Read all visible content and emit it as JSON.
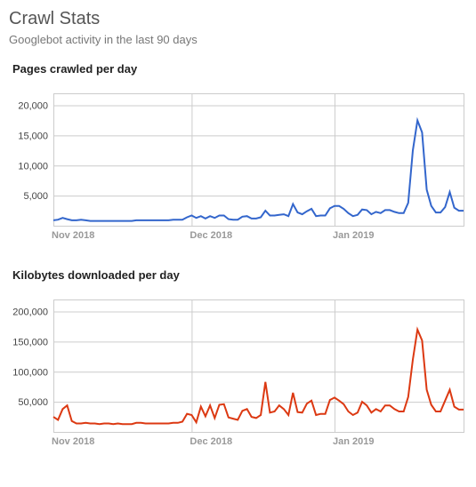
{
  "header": {
    "title": "Crawl Stats",
    "subtitle": "Googlebot activity in the last 90 days"
  },
  "pages_chart": {
    "title": "Pages crawled per day",
    "color": "#3366cc",
    "y_ticks": [
      "5,000",
      "10,000",
      "15,000",
      "20,000"
    ],
    "x_ticks": [
      "Nov 2018",
      "Dec 2018",
      "Jan 2019"
    ]
  },
  "kb_chart": {
    "title": "Kilobytes downloaded per day",
    "color": "#dc3912",
    "y_ticks": [
      "50,000",
      "100,000",
      "150,000",
      "200,000"
    ],
    "x_ticks": [
      "Nov 2018",
      "Dec 2018",
      "Jan 2019"
    ]
  },
  "chart_data": [
    {
      "type": "line",
      "title": "Pages crawled per day",
      "xlabel": "",
      "ylabel": "",
      "ylim": [
        0,
        22000
      ],
      "x_tick_positions": [
        0,
        30,
        61
      ],
      "x_tick_labels": [
        "Nov 2018",
        "Dec 2018",
        "Jan 2019"
      ],
      "y_tick_values": [
        5000,
        10000,
        15000,
        20000
      ],
      "series": [
        {
          "name": "Pages crawled per day",
          "color": "#3366cc",
          "x": [
            0,
            1,
            2,
            3,
            4,
            5,
            6,
            7,
            8,
            9,
            10,
            11,
            12,
            13,
            14,
            15,
            16,
            17,
            18,
            19,
            20,
            21,
            22,
            23,
            24,
            25,
            26,
            27,
            28,
            29,
            30,
            31,
            32,
            33,
            34,
            35,
            36,
            37,
            38,
            39,
            40,
            41,
            42,
            43,
            44,
            45,
            46,
            47,
            48,
            49,
            50,
            51,
            52,
            53,
            54,
            55,
            56,
            57,
            58,
            59,
            60,
            61,
            62,
            63,
            64,
            65,
            66,
            67,
            68,
            69,
            70,
            71,
            72,
            73,
            74,
            75,
            76,
            77,
            78,
            79,
            80,
            81,
            82,
            83,
            84,
            85,
            86,
            87,
            88,
            89
          ],
          "values": [
            900,
            1000,
            1300,
            1100,
            900,
            900,
            1000,
            900,
            800,
            800,
            800,
            800,
            800,
            800,
            800,
            800,
            800,
            800,
            900,
            900,
            900,
            900,
            900,
            900,
            900,
            900,
            1000,
            1000,
            1000,
            1400,
            1700,
            1300,
            1600,
            1200,
            1600,
            1300,
            1700,
            1700,
            1100,
            1000,
            1000,
            1500,
            1600,
            1200,
            1200,
            1400,
            2500,
            1700,
            1700,
            1800,
            1900,
            1600,
            3600,
            2200,
            1900,
            2400,
            2800,
            1600,
            1700,
            1700,
            2900,
            3300,
            3300,
            2800,
            2100,
            1600,
            1800,
            2700,
            2600,
            1900,
            2300,
            2100,
            2600,
            2600,
            2300,
            2100,
            2100,
            3800,
            12500,
            17500,
            15500,
            6000,
            3300,
            2200,
            2200,
            3100,
            5600,
            3000,
            2500,
            2500
          ]
        }
      ]
    },
    {
      "type": "line",
      "title": "Kilobytes downloaded per day",
      "xlabel": "",
      "ylabel": "",
      "ylim": [
        0,
        220000
      ],
      "x_tick_positions": [
        0,
        30,
        61
      ],
      "x_tick_labels": [
        "Nov 2018",
        "Dec 2018",
        "Jan 2019"
      ],
      "y_tick_values": [
        50000,
        100000,
        150000,
        200000
      ],
      "series": [
        {
          "name": "Kilobytes downloaded per day",
          "color": "#dc3912",
          "x": [
            0,
            1,
            2,
            3,
            4,
            5,
            6,
            7,
            8,
            9,
            10,
            11,
            12,
            13,
            14,
            15,
            16,
            17,
            18,
            19,
            20,
            21,
            22,
            23,
            24,
            25,
            26,
            27,
            28,
            29,
            30,
            31,
            32,
            33,
            34,
            35,
            36,
            37,
            38,
            39,
            40,
            41,
            42,
            43,
            44,
            45,
            46,
            47,
            48,
            49,
            50,
            51,
            52,
            53,
            54,
            55,
            56,
            57,
            58,
            59,
            60,
            61,
            62,
            63,
            64,
            65,
            66,
            67,
            68,
            69,
            70,
            71,
            72,
            73,
            74,
            75,
            76,
            77,
            78,
            79,
            80,
            81,
            82,
            83,
            84,
            85,
            86,
            87,
            88,
            89
          ],
          "values": [
            25000,
            20000,
            38000,
            44000,
            18000,
            14000,
            14000,
            15000,
            14000,
            14000,
            13000,
            14000,
            14000,
            13000,
            14000,
            13000,
            13000,
            13000,
            15000,
            15000,
            14000,
            14000,
            14000,
            14000,
            14000,
            14000,
            15000,
            15000,
            17000,
            30000,
            28000,
            16000,
            42000,
            26000,
            44000,
            23000,
            45000,
            46000,
            24000,
            22000,
            20000,
            35000,
            38000,
            25000,
            23000,
            28000,
            83000,
            32000,
            34000,
            44000,
            38000,
            28000,
            65000,
            33000,
            32000,
            47000,
            52000,
            28000,
            30000,
            30000,
            53000,
            57000,
            52000,
            46000,
            34000,
            28000,
            32000,
            50000,
            44000,
            32000,
            38000,
            34000,
            44000,
            44000,
            38000,
            34000,
            34000,
            58000,
            120000,
            170000,
            152000,
            70000,
            45000,
            34000,
            34000,
            52000,
            70000,
            42000,
            37000,
            37000
          ]
        }
      ]
    }
  ]
}
